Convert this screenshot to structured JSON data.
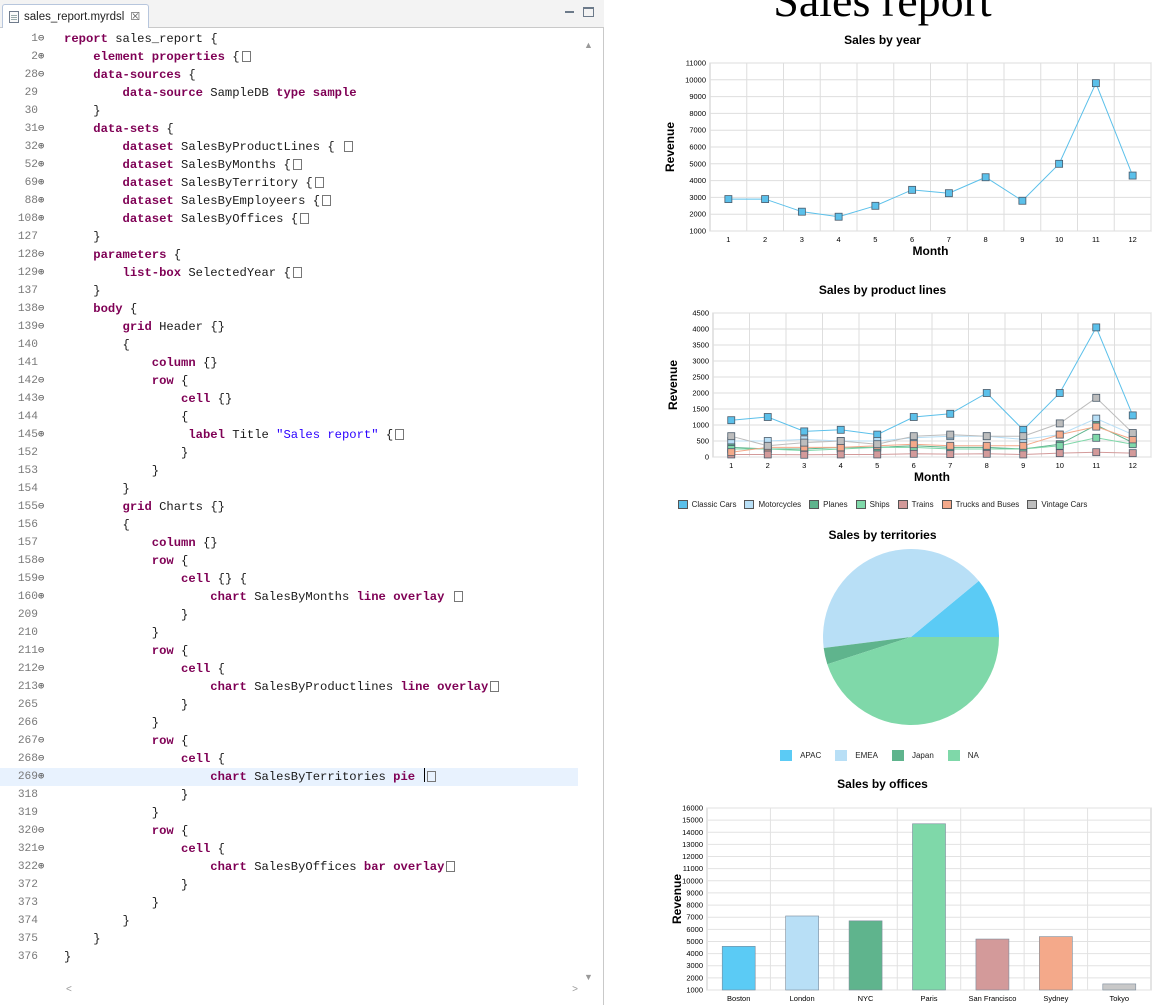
{
  "editor": {
    "tab_label": "sales_report.myrdsl",
    "tab_close": "☒",
    "lines": [
      {
        "ln": "1",
        "fold": "⊖",
        "tokens": [
          {
            "t": "report sales_report {",
            "c": "kw-partial"
          }
        ],
        "raw": "report sales_report {"
      },
      {
        "ln": "2",
        "fold": "⊕",
        "raw": "    element properties {",
        "collapsed": true
      },
      {
        "ln": "28",
        "fold": "⊖",
        "raw": "    data-sources {"
      },
      {
        "ln": "29",
        "fold": "",
        "raw": "        data-source SampleDB type sample"
      },
      {
        "ln": "30",
        "fold": "",
        "raw": "    }"
      },
      {
        "ln": "31",
        "fold": "⊖",
        "raw": "    data-sets {"
      },
      {
        "ln": "32",
        "fold": "⊕",
        "raw": "        dataset SalesByProductLines { ",
        "collapsed": true
      },
      {
        "ln": "52",
        "fold": "⊕",
        "raw": "        dataset SalesByMonths {",
        "collapsed": true
      },
      {
        "ln": "69",
        "fold": "⊕",
        "raw": "        dataset SalesByTerritory {",
        "collapsed": true
      },
      {
        "ln": "88",
        "fold": "⊕",
        "raw": "        dataset SalesByEmployeers {",
        "collapsed": true
      },
      {
        "ln": "108",
        "fold": "⊕",
        "raw": "        dataset SalesByOffices {",
        "collapsed": true
      },
      {
        "ln": "127",
        "fold": "",
        "raw": "    }"
      },
      {
        "ln": "128",
        "fold": "⊖",
        "raw": "    parameters {"
      },
      {
        "ln": "129",
        "fold": "⊕",
        "raw": "        list-box SelectedYear {",
        "collapsed": true
      },
      {
        "ln": "137",
        "fold": "",
        "raw": "    }"
      },
      {
        "ln": "138",
        "fold": "⊖",
        "raw": "    body {"
      },
      {
        "ln": "139",
        "fold": "⊖",
        "raw": "        grid Header {}"
      },
      {
        "ln": "140",
        "fold": "",
        "raw": "        {"
      },
      {
        "ln": "141",
        "fold": "",
        "raw": "            column {}"
      },
      {
        "ln": "142",
        "fold": "⊖",
        "raw": "            row {"
      },
      {
        "ln": "143",
        "fold": "⊖",
        "raw": "                cell {}"
      },
      {
        "ln": "144",
        "fold": "",
        "raw": "                {"
      },
      {
        "ln": "145",
        "fold": "⊕",
        "raw": "                 label Title \"Sales report\" {",
        "collapsed": true
      },
      {
        "ln": "152",
        "fold": "",
        "raw": "                }"
      },
      {
        "ln": "153",
        "fold": "",
        "raw": "            }"
      },
      {
        "ln": "154",
        "fold": "",
        "raw": "        }"
      },
      {
        "ln": "155",
        "fold": "⊖",
        "raw": "        grid Charts {}"
      },
      {
        "ln": "156",
        "fold": "",
        "raw": "        {"
      },
      {
        "ln": "157",
        "fold": "",
        "raw": "            column {}"
      },
      {
        "ln": "158",
        "fold": "⊖",
        "raw": "            row {"
      },
      {
        "ln": "159",
        "fold": "⊖",
        "raw": "                cell {} {"
      },
      {
        "ln": "160",
        "fold": "⊕",
        "raw": "                    chart SalesByMonths line overlay ",
        "collapsed": true
      },
      {
        "ln": "209",
        "fold": "",
        "raw": "                }"
      },
      {
        "ln": "210",
        "fold": "",
        "raw": "            }"
      },
      {
        "ln": "211",
        "fold": "⊖",
        "raw": "            row {"
      },
      {
        "ln": "212",
        "fold": "⊖",
        "raw": "                cell {"
      },
      {
        "ln": "213",
        "fold": "⊕",
        "raw": "                    chart SalesByProductlines line overlay",
        "collapsed": true
      },
      {
        "ln": "265",
        "fold": "",
        "raw": "                }"
      },
      {
        "ln": "266",
        "fold": "",
        "raw": "            }"
      },
      {
        "ln": "267",
        "fold": "⊖",
        "raw": "            row {"
      },
      {
        "ln": "268",
        "fold": "⊖",
        "raw": "                cell {"
      },
      {
        "ln": "269",
        "fold": "⊕",
        "raw": "                    chart SalesByTerritories pie ",
        "collapsed": true,
        "highlight": true
      },
      {
        "ln": "318",
        "fold": "",
        "raw": "                }"
      },
      {
        "ln": "319",
        "fold": "",
        "raw": "            }"
      },
      {
        "ln": "320",
        "fold": "⊖",
        "raw": "            row {"
      },
      {
        "ln": "321",
        "fold": "⊖",
        "raw": "                cell {"
      },
      {
        "ln": "322",
        "fold": "⊕",
        "raw": "                    chart SalesByOffices bar overlay",
        "collapsed": true
      },
      {
        "ln": "372",
        "fold": "",
        "raw": "                }"
      },
      {
        "ln": "373",
        "fold": "",
        "raw": "            }"
      },
      {
        "ln": "374",
        "fold": "",
        "raw": "        }"
      },
      {
        "ln": "375",
        "fold": "",
        "raw": "    }"
      },
      {
        "ln": "376",
        "fold": "",
        "raw": "}"
      }
    ],
    "keywords": [
      "report",
      "element",
      "properties",
      "data-sources",
      "data-source",
      "type",
      "sample",
      "data-sets",
      "dataset",
      "parameters",
      "list-box",
      "body",
      "grid",
      "column",
      "row",
      "cell",
      "label",
      "chart",
      "line",
      "overlay",
      "pie",
      "bar"
    ]
  },
  "report": {
    "title": "Sales report"
  },
  "chart_data": [
    {
      "type": "line",
      "title": "Sales by year",
      "xlabel": "Month",
      "ylabel": "Revenue",
      "x": [
        1,
        2,
        3,
        4,
        5,
        6,
        7,
        8,
        9,
        10,
        11,
        12
      ],
      "ylim": [
        1000,
        11000
      ],
      "yticks": [
        1000,
        2000,
        3000,
        4000,
        5000,
        6000,
        7000,
        8000,
        9000,
        10000,
        11000
      ],
      "grid": true,
      "series": [
        {
          "color": "#5bc0ea",
          "values": [
            2900,
            2900,
            2150,
            1850,
            2500,
            3450,
            3250,
            4200,
            2800,
            5000,
            9800,
            4300
          ]
        }
      ]
    },
    {
      "type": "line",
      "title": "Sales by product lines",
      "xlabel": "Month",
      "ylabel": "Revenue",
      "x": [
        1,
        2,
        3,
        4,
        5,
        6,
        7,
        8,
        9,
        10,
        11,
        12
      ],
      "ylim": [
        0,
        4500
      ],
      "yticks": [
        0,
        500,
        1000,
        1500,
        2000,
        2500,
        3000,
        3500,
        4000,
        4500
      ],
      "grid": true,
      "legend_position": "bottom",
      "series": [
        {
          "name": "Classic Cars",
          "color": "#5bc0ea",
          "values": [
            1150,
            1250,
            800,
            850,
            700,
            1250,
            1350,
            2000,
            850,
            2000,
            4050,
            1300
          ]
        },
        {
          "name": "Motorcycles",
          "color": "#b8dff6",
          "values": [
            500,
            500,
            550,
            500,
            500,
            600,
            650,
            650,
            550,
            700,
            1200,
            700
          ]
        },
        {
          "name": "Planes",
          "color": "#5fb48d",
          "values": [
            300,
            250,
            250,
            300,
            300,
            350,
            300,
            300,
            250,
            400,
            1000,
            450
          ]
        },
        {
          "name": "Ships",
          "color": "#7fd8a9",
          "values": [
            250,
            250,
            200,
            250,
            300,
            300,
            250,
            250,
            250,
            350,
            600,
            400
          ]
        },
        {
          "name": "Trains",
          "color": "#d39a9a",
          "values": [
            80,
            80,
            70,
            80,
            80,
            100,
            90,
            100,
            80,
            120,
            150,
            120
          ]
        },
        {
          "name": "Trucks and Buses",
          "color": "#f4a98a",
          "values": [
            150,
            300,
            300,
            300,
            350,
            400,
            350,
            350,
            350,
            700,
            950,
            550
          ]
        },
        {
          "name": "Vintage Cars",
          "color": "#bdbdbd",
          "values": [
            650,
            350,
            450,
            500,
            400,
            650,
            700,
            650,
            650,
            1050,
            1850,
            750
          ]
        }
      ]
    },
    {
      "type": "pie",
      "title": "Sales by territories",
      "legend_position": "bottom",
      "slices": [
        {
          "name": "APAC",
          "color": "#5bcbf5",
          "value": 11
        },
        {
          "name": "EMEA",
          "color": "#b8dff6",
          "value": 41
        },
        {
          "name": "Japan",
          "color": "#5fb48d",
          "value": 3
        },
        {
          "name": "NA",
          "color": "#7fd8a9",
          "value": 45
        }
      ]
    },
    {
      "type": "bar",
      "title": "Sales by offices",
      "ylabel": "Revenue",
      "ylim": [
        1000,
        16000
      ],
      "yticks": [
        1000,
        2000,
        3000,
        4000,
        5000,
        6000,
        7000,
        8000,
        9000,
        10000,
        11000,
        12000,
        13000,
        14000,
        15000,
        16000
      ],
      "grid": true,
      "categories": [
        "Boston",
        "London",
        "NYC",
        "Paris",
        "San Francisco",
        "Sydney",
        "Tokyo"
      ],
      "values": [
        4600,
        7100,
        6700,
        14700,
        5200,
        5400,
        1500
      ],
      "colors": [
        "#5bcbf5",
        "#b8dff6",
        "#5fb48d",
        "#7fd8a9",
        "#d39a9a",
        "#f4a98a",
        "#c8c8c8"
      ]
    }
  ]
}
